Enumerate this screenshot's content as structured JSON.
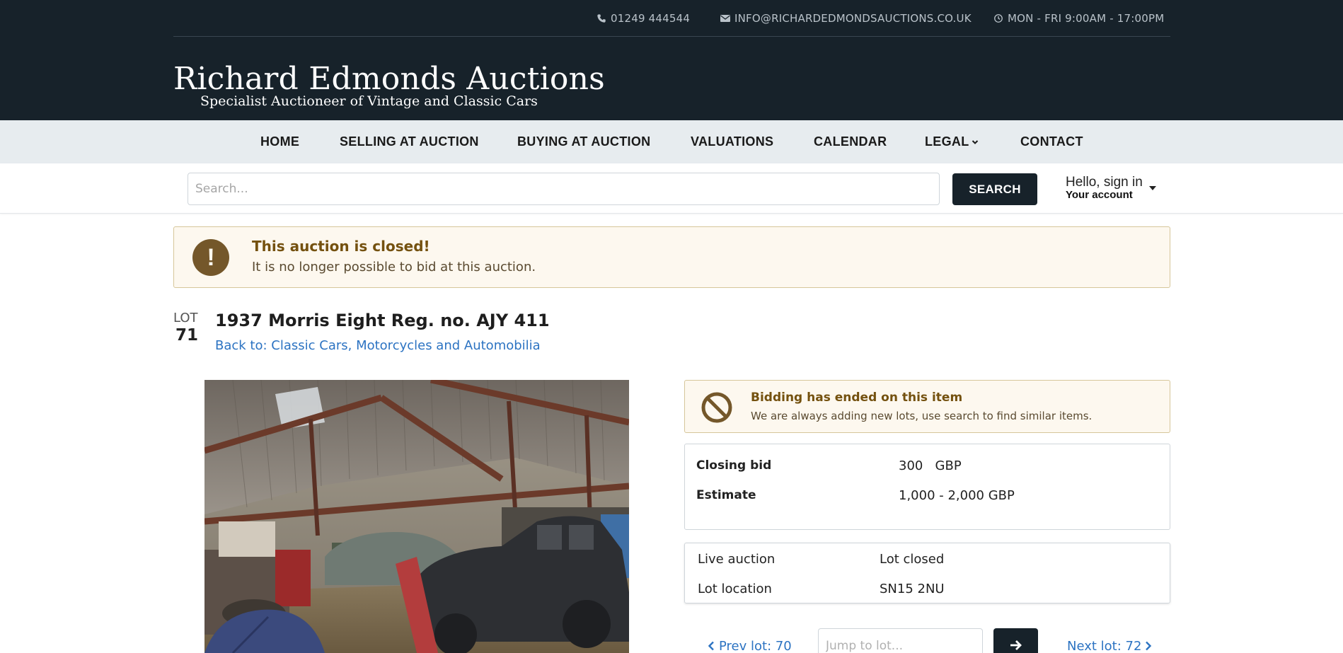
{
  "contact": {
    "phone": "01249 444544",
    "email": "INFO@RICHARDEDMONDSAUCTIONS.CO.UK",
    "hours": "MON - FRI 9:00AM - 17:00PM"
  },
  "logo": {
    "title": "Richard Edmonds Auctions",
    "subtitle": "Specialist Auctioneer of Vintage and Classic Cars"
  },
  "nav": {
    "items": [
      "HOME",
      "SELLING AT AUCTION",
      "BUYING AT AUCTION",
      "VALUATIONS",
      "CALENDAR",
      "LEGAL",
      "CONTACT"
    ]
  },
  "search": {
    "placeholder": "Search...",
    "button": "SEARCH"
  },
  "account": {
    "hello": "Hello, sign in",
    "label": "Your account"
  },
  "banner": {
    "title": "This auction is closed!",
    "text": "It is no longer possible to bid at this auction."
  },
  "lot": {
    "label": "LOT",
    "number": "71",
    "title": "1937 Morris Eight Reg. no. AJY 411",
    "back_link": "Back to: Classic Cars, Motorcycles and Automobilia"
  },
  "bidding_ended": {
    "title": "Bidding has ended on this item",
    "text": "We are always adding new lots, use search to find similar items."
  },
  "bid": {
    "closing_label": "Closing bid",
    "closing_value": "300   GBP",
    "estimate_label": "Estimate",
    "estimate_value": "1,000 - 2,000 GBP"
  },
  "info": {
    "auction_label": "Live auction",
    "auction_value": "Lot closed",
    "location_label": "Lot location",
    "location_value": "SN15 2NU"
  },
  "pager": {
    "prev": "Prev lot: 70",
    "jump_placeholder": "Jump to lot...",
    "next": "Next lot: 72"
  },
  "icons": {
    "phone": "phone-icon",
    "email": "envelope-icon",
    "hours": "clock-icon",
    "alert": "exclamation-icon",
    "ended": "ban-icon"
  },
  "colors": {
    "header_bg": "#17222a",
    "nav_bg": "#e7ecef",
    "alert_bg": "#fdf8ef",
    "alert_border": "#d6c69a",
    "alert_icon": "#74572a",
    "link": "#2c73c2"
  }
}
